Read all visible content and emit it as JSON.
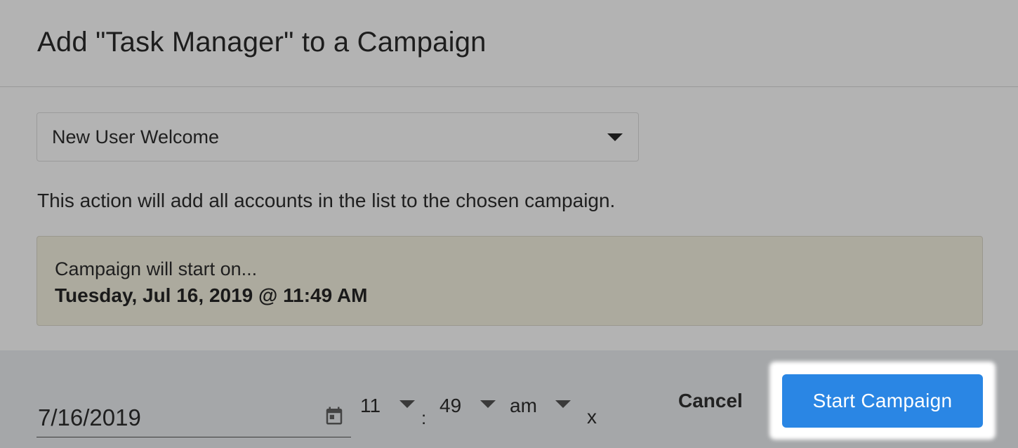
{
  "dialog": {
    "title": "Add \"Task Manager\" to a Campaign"
  },
  "campaign_select": {
    "selected": "New User Welcome"
  },
  "info_text": "This action will add all accounts in the list to the chosen campaign.",
  "notice": {
    "line1": "Campaign will start on...",
    "line2": "Tuesday, Jul 16, 2019 @ 11:49 AM"
  },
  "schedule": {
    "date": "7/16/2019",
    "hour": "11",
    "separator": ":",
    "minute": "49",
    "ampm": "am",
    "clear": "x"
  },
  "footer": {
    "cancel_label": "Cancel",
    "start_label": "Start Campaign"
  },
  "colors": {
    "overlay_background": "#b3b3b3",
    "footer_background": "#a5a7a9",
    "notice_background": "#acaa9e",
    "primary_button": "#2a86e4"
  }
}
